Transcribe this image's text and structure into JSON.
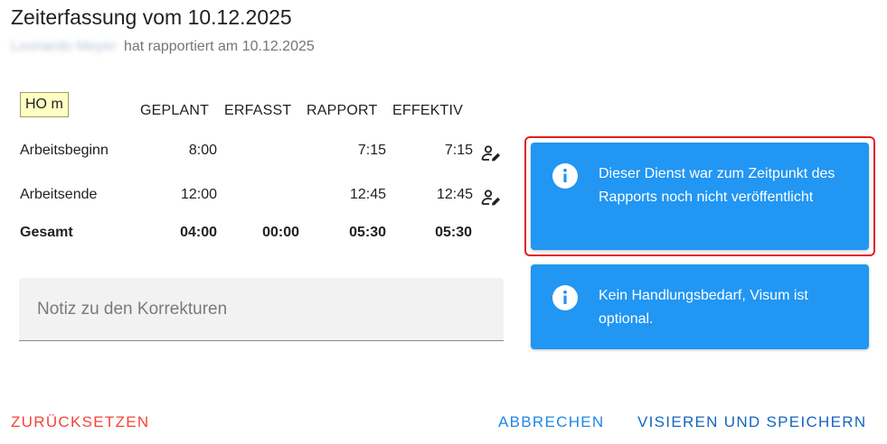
{
  "header": {
    "title": "Zeiterfassung vom 10.12.2025",
    "employee_name": "Leonardo Meyer",
    "reported_text": "hat rapportiert am 10.12.2025"
  },
  "badge": {
    "label": "HO m"
  },
  "table": {
    "columns": [
      "GEPLANT",
      "ERFASST",
      "RAPPORT",
      "EFFEKTIV"
    ],
    "rows": [
      {
        "label": "Arbeitsbeginn",
        "geplant": "8:00",
        "erfasst": "",
        "rapport": "7:15",
        "effektiv": "7:15",
        "icon": "user-edit-icon"
      },
      {
        "label": "Arbeitsende",
        "geplant": "12:00",
        "erfasst": "",
        "rapport": "12:45",
        "effektiv": "12:45",
        "icon": "user-edit-icon"
      }
    ],
    "total": {
      "label": "Gesamt",
      "geplant": "04:00",
      "erfasst": "00:00",
      "rapport": "05:30",
      "effektiv": "05:30"
    }
  },
  "note": {
    "placeholder": "Notiz zu den Korrekturen",
    "value": ""
  },
  "alerts": [
    {
      "icon": "info-icon",
      "text": "Dieser Dienst war zum Zeitpunkt des Rapports noch nicht veröffentlicht",
      "highlighted": true
    },
    {
      "icon": "info-icon",
      "text": "Kein Handlungsbedarf, Visum ist optional.",
      "highlighted": false
    }
  ],
  "actions": {
    "reset": "ZURÜCKSETZEN",
    "cancel": "ABBRECHEN",
    "save": "VISIEREN UND SPEICHERN"
  },
  "colors": {
    "info": "#2196f3",
    "danger": "#f44336",
    "primary": "#1e88e5",
    "highlight_border": "#e02020",
    "badge_bg": "#ffffc4"
  }
}
